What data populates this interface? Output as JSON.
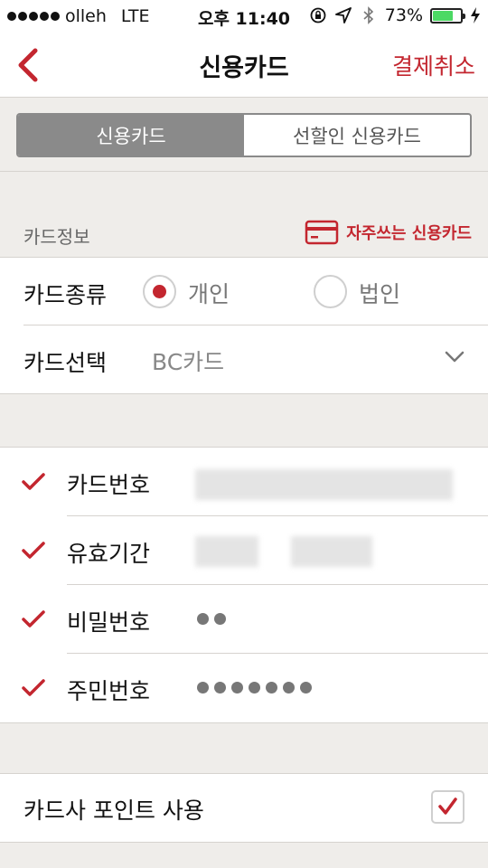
{
  "status_bar": {
    "carrier": "olleh",
    "network": "LTE",
    "time": "오후 11:40",
    "battery_percent": "73%",
    "battery_level": 0.73
  },
  "nav": {
    "title": "신용카드",
    "cancel_label": "결제취소"
  },
  "tabs": [
    {
      "label": "신용카드",
      "selected": true
    },
    {
      "label": "선할인 신용카드",
      "selected": false
    }
  ],
  "card_info": {
    "section_label": "카드정보",
    "favorite_cards_label": "자주쓰는 신용카드",
    "card_type": {
      "label": "카드종류",
      "options": [
        {
          "label": "개인",
          "selected": true
        },
        {
          "label": "법인",
          "selected": false
        }
      ]
    },
    "card_select": {
      "label": "카드선택",
      "value": "BC카드"
    }
  },
  "fields": [
    {
      "label": "카드번호",
      "checked": true,
      "value": ""
    },
    {
      "label": "유효기간",
      "checked": true,
      "value": ""
    },
    {
      "label": "비밀번호",
      "checked": true,
      "value": "••"
    },
    {
      "label": "주민번호",
      "checked": true,
      "value": "•••••••"
    }
  ],
  "points": {
    "label": "카드사 포인트 사용",
    "checked": true
  },
  "colors": {
    "accent": "#c3262f",
    "background": "#efedea",
    "segment_active": "#8a8a8a"
  }
}
